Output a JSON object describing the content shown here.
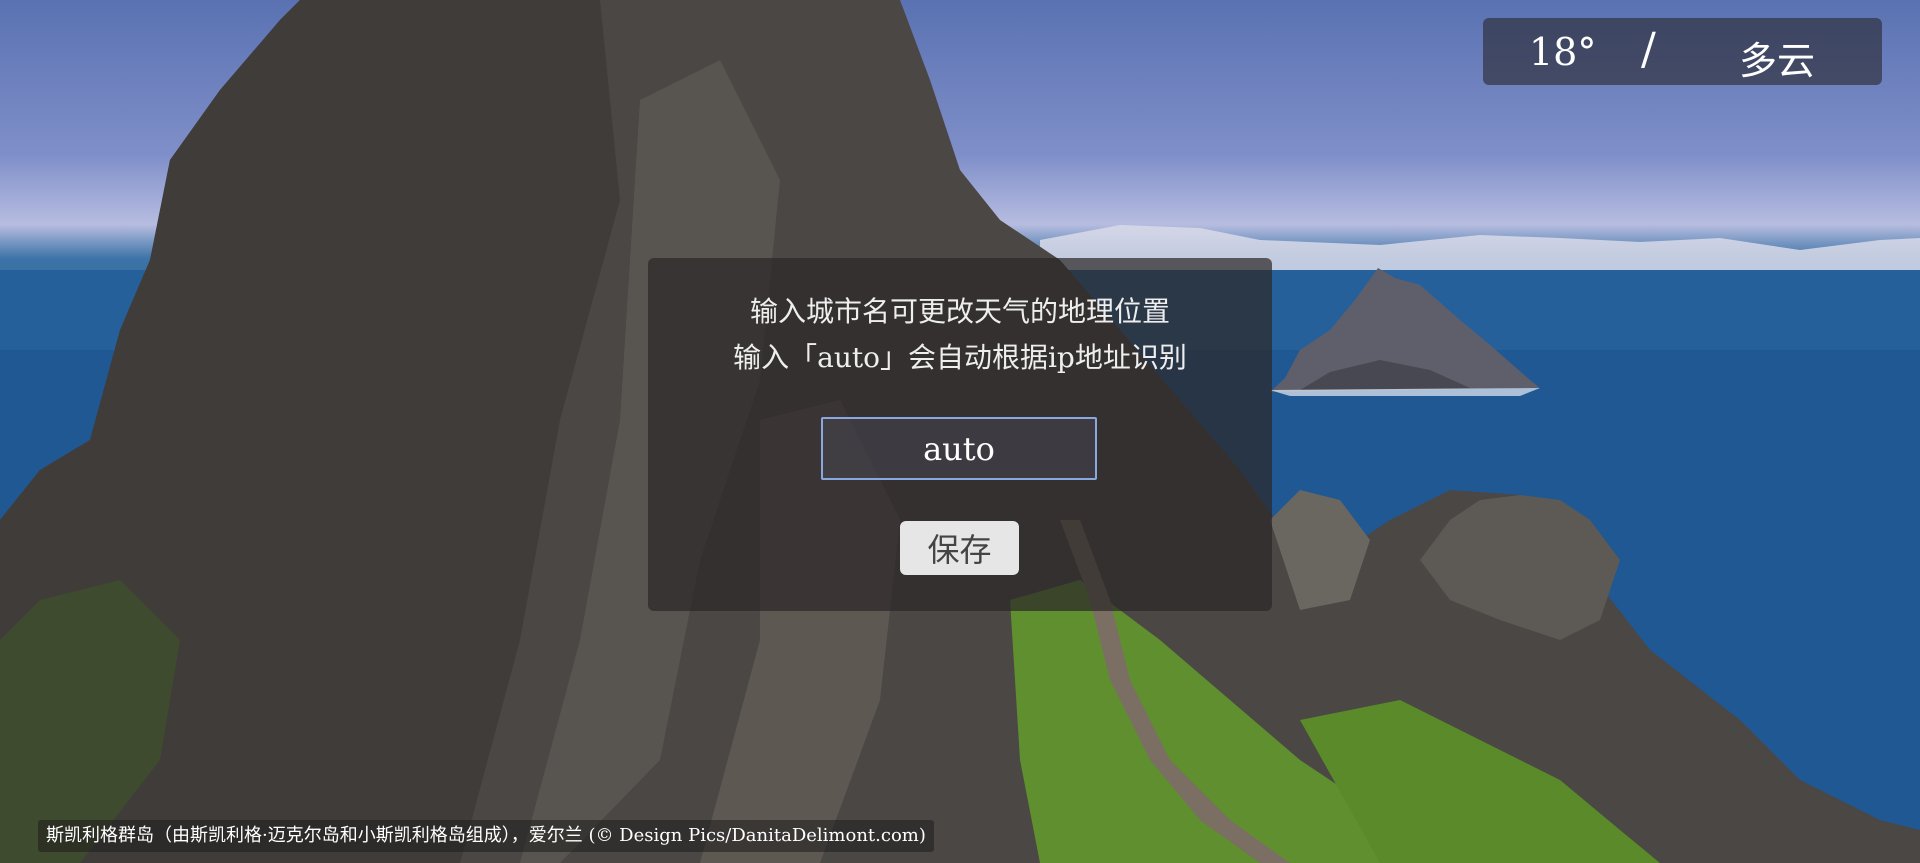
{
  "weather": {
    "temperature": "18°",
    "separator": "/",
    "condition": "多云"
  },
  "dialog": {
    "hint_line1": "输入城市名可更改天气的地理位置",
    "hint_line2": "输入「auto」会自动根据ip地址识别",
    "city_input_value": "auto",
    "save_label": "保存"
  },
  "caption": {
    "text": "斯凯利格群岛（由斯凯利格·迈克尔岛和小斯凯利格岛组成），爱尔兰 (© Design Pics/DanitaDelimont.com)"
  }
}
